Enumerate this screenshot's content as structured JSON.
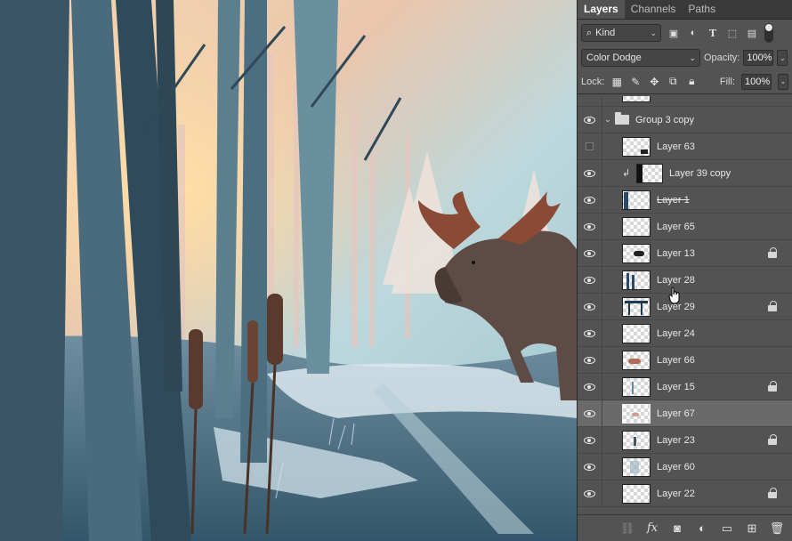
{
  "tabs": [
    {
      "label": "Layers",
      "active": true
    },
    {
      "label": "Channels",
      "active": false
    },
    {
      "label": "Paths",
      "active": false
    }
  ],
  "filter": {
    "kind_label": "Kind",
    "icons": [
      "image-filter-icon",
      "adjustment-filter-icon",
      "type-filter-icon",
      "shape-filter-icon",
      "smart-object-filter-icon"
    ]
  },
  "blend": {
    "mode": "Color Dodge",
    "opacity_label": "Opacity:",
    "opacity_value": "100%"
  },
  "lock": {
    "label": "Lock:",
    "fill_label": "Fill:",
    "fill_value": "100%"
  },
  "layers": [
    {
      "name": "Group 3 copy",
      "type": "group",
      "visible": true
    },
    {
      "name": "Layer 63",
      "visible": false,
      "indent": 1
    },
    {
      "name": "Layer 39 copy",
      "visible": true,
      "indent": 2,
      "clipped": true
    },
    {
      "name": "Layer 1",
      "visible": true,
      "indent": 1,
      "strike": true
    },
    {
      "name": "Layer 65",
      "visible": true,
      "indent": 1
    },
    {
      "name": "Layer 13",
      "visible": true,
      "indent": 1,
      "locked": true
    },
    {
      "name": "Layer 28",
      "visible": true,
      "indent": 1
    },
    {
      "name": "Layer 29",
      "visible": true,
      "indent": 1,
      "locked": true
    },
    {
      "name": "Layer 24",
      "visible": true,
      "indent": 1
    },
    {
      "name": "Layer 66",
      "visible": true,
      "indent": 1
    },
    {
      "name": "Layer 15",
      "visible": true,
      "indent": 1,
      "locked": true
    },
    {
      "name": "Layer 67",
      "visible": true,
      "indent": 1,
      "selected": true
    },
    {
      "name": "Layer 23",
      "visible": true,
      "indent": 1,
      "locked": true
    },
    {
      "name": "Layer 60",
      "visible": true,
      "indent": 1
    },
    {
      "name": "Layer 22",
      "visible": true,
      "indent": 1,
      "locked": true
    }
  ],
  "footer_icons": [
    "link-layers-icon",
    "fx-icon",
    "add-mask-icon",
    "adjustment-layer-icon",
    "new-group-icon",
    "new-layer-icon",
    "trash-icon"
  ]
}
